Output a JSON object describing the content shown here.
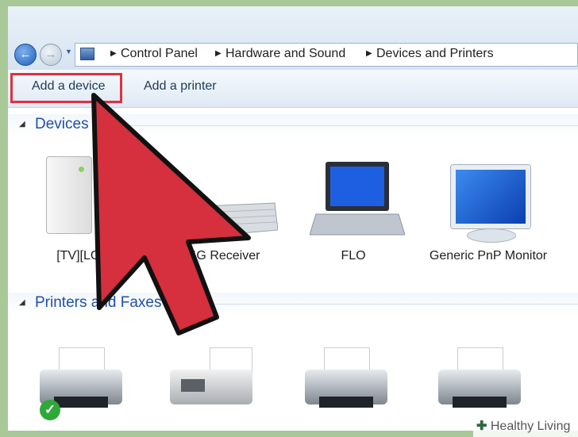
{
  "breadcrumbs": [
    "Control Panel",
    "Hardware and Sound",
    "Devices and Printers"
  ],
  "toolbar": {
    "add_device": "Add a device",
    "add_printer": "Add a printer"
  },
  "sections": {
    "devices": "Devices",
    "printers": "Printers and Faxes"
  },
  "devices": [
    {
      "label": "[TV][LG]",
      "icon": "tv-box-icon"
    },
    {
      "label": "4G Receiver",
      "icon": "keyboard-icon"
    },
    {
      "label": "FLO",
      "icon": "laptop-icon"
    },
    {
      "label": "Generic PnP Monitor",
      "icon": "monitor-icon"
    }
  ],
  "printers": [
    {
      "icon": "printer-default-icon"
    },
    {
      "icon": "fax-icon"
    },
    {
      "icon": "printer-icon"
    },
    {
      "icon": "printer-icon"
    }
  ],
  "colors": {
    "highlight": "#e03040",
    "arrow": "#d62f3d",
    "link": "#1f4fa8",
    "background": "#a8c898"
  },
  "watermark": "Healthy Living"
}
